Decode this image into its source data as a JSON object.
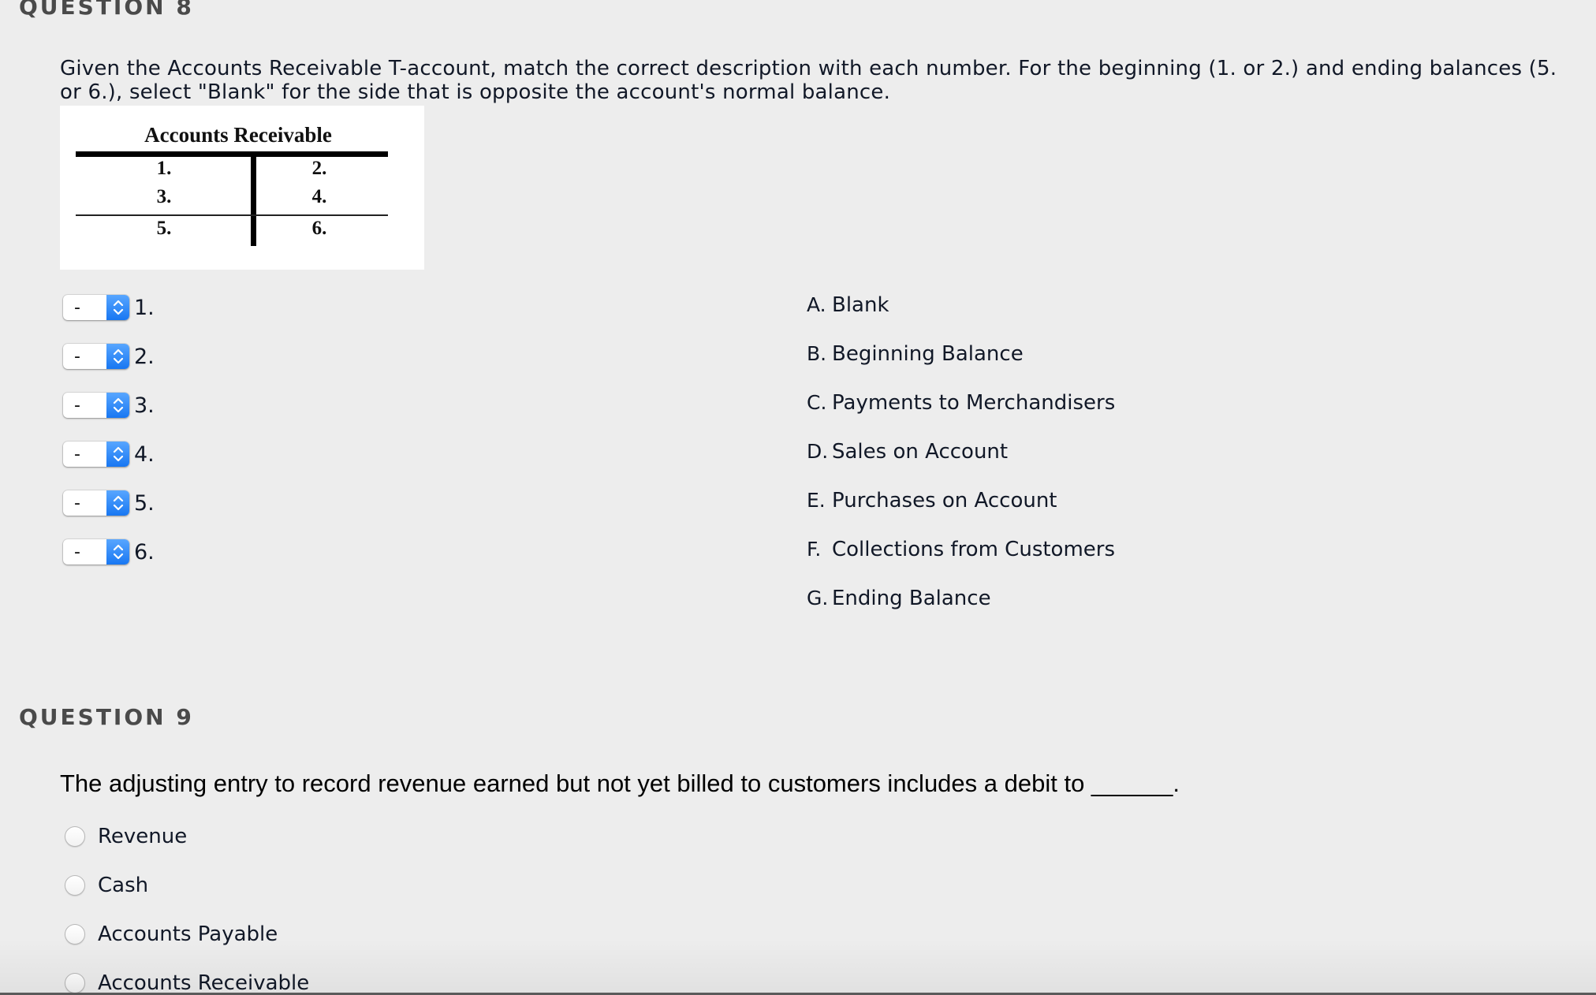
{
  "question8": {
    "heading": "QUESTION 8",
    "prompt": "Given the Accounts Receivable T-account, match the correct description with each number. For the beginning (1. or 2.) and ending balances (5. or 6.), select \"Blank\" for the side that is opposite the account's normal balance.",
    "t_account": {
      "title": "Accounts Receivable",
      "rows": [
        {
          "left": "1.",
          "right": "2."
        },
        {
          "left": "3.",
          "right": "4."
        },
        {
          "left": "5.",
          "right": "6."
        }
      ]
    },
    "matches": [
      {
        "number": "1.",
        "selected": "-"
      },
      {
        "number": "2.",
        "selected": "-"
      },
      {
        "number": "3.",
        "selected": "-"
      },
      {
        "number": "4.",
        "selected": "-"
      },
      {
        "number": "5.",
        "selected": "-"
      },
      {
        "number": "6.",
        "selected": "-"
      }
    ],
    "choices": [
      {
        "letter": "A.",
        "text": "Blank"
      },
      {
        "letter": "B.",
        "text": "Beginning Balance"
      },
      {
        "letter": "C.",
        "text": "Payments to Merchandisers"
      },
      {
        "letter": "D.",
        "text": "Sales on Account"
      },
      {
        "letter": "E.",
        "text": "Purchases on Account"
      },
      {
        "letter": "F.",
        "text": "Collections from Customers"
      },
      {
        "letter": "G.",
        "text": "Ending Balance"
      }
    ]
  },
  "question9": {
    "heading": "QUESTION 9",
    "prompt": "The adjusting entry to record revenue earned but not yet billed to customers includes a debit to ______.",
    "options": [
      {
        "label": "Revenue",
        "selected": false
      },
      {
        "label": "Cash",
        "selected": false
      },
      {
        "label": "Accounts Payable",
        "selected": false
      },
      {
        "label": "Accounts Receivable",
        "selected": false
      }
    ]
  },
  "icons": {
    "select_arrow": "up-down-chevron",
    "radio": "empty-circle"
  },
  "colors": {
    "background": "#ededed",
    "select_accent": "#1877f2",
    "heading": "#4a4a4a",
    "text": "#111827"
  }
}
